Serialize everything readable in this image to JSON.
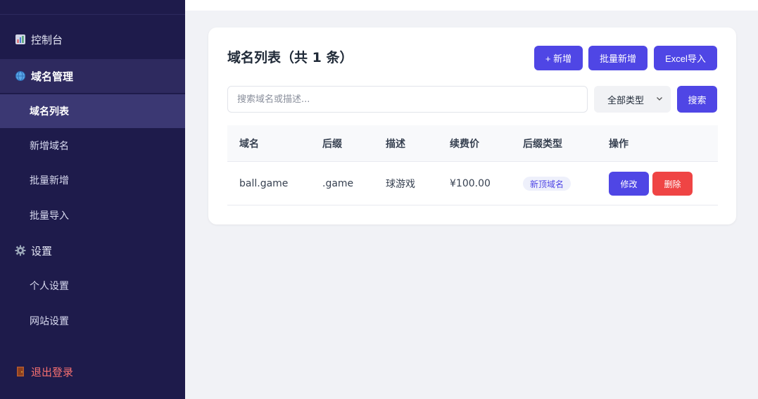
{
  "sidebar": {
    "items": [
      {
        "label": "控制台",
        "icon": "bar-chart-icon"
      },
      {
        "label": "域名管理",
        "icon": "globe-icon"
      },
      {
        "label": "域名列表"
      },
      {
        "label": "新增域名"
      },
      {
        "label": "批量新增"
      },
      {
        "label": "批量导入"
      },
      {
        "label": "设置",
        "icon": "gear-icon"
      },
      {
        "label": "个人设置"
      },
      {
        "label": "网站设置"
      },
      {
        "label": "退出登录",
        "icon": "door-icon"
      }
    ]
  },
  "main": {
    "title": "域名列表（共 1 条）",
    "buttons": {
      "add": "+ 新增",
      "batch_add": "批量新增",
      "excel_import": "Excel导入"
    },
    "search": {
      "placeholder": "搜索域名或描述...",
      "value": ""
    },
    "filter": {
      "selected": "全部类型"
    },
    "search_button": "搜索",
    "table": {
      "headers": [
        "域名",
        "后缀",
        "描述",
        "续费价",
        "后缀类型",
        "操作"
      ],
      "rows": [
        {
          "domain": "ball.game",
          "suffix": ".game",
          "desc": "球游戏",
          "price": "¥100.00",
          "type": "新顶域名",
          "edit": "修改",
          "delete": "删除"
        }
      ]
    }
  },
  "colors": {
    "accent": "#4f46e5",
    "danger": "#ef4444",
    "sidebar_bg": "#1e1b4b",
    "logout": "#f87171"
  }
}
